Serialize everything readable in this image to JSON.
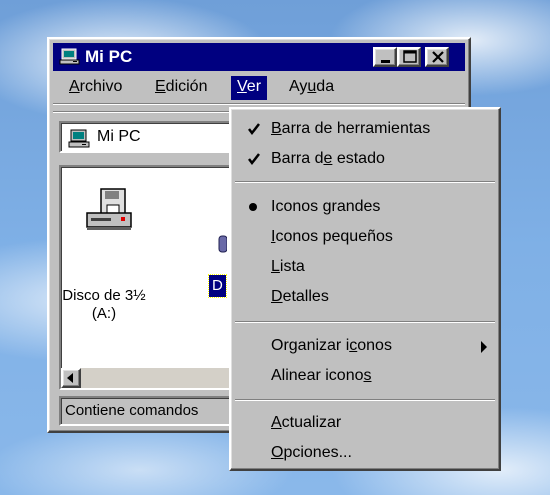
{
  "window": {
    "title": "Mi PC",
    "colors": {
      "titlebar": "#000080",
      "face": "#c0c0c0",
      "menu_highlight": "#000080"
    }
  },
  "menubar": {
    "items": [
      {
        "label": "Archivo",
        "underline": "A",
        "rest": "rchivo"
      },
      {
        "label": "Edición",
        "underline": "E",
        "rest": "dición"
      },
      {
        "label": "Ver",
        "underline": "V",
        "rest": "er"
      },
      {
        "label": "Ayuda",
        "pre": "Ay",
        "underline": "u",
        "rest": "da"
      }
    ]
  },
  "address": {
    "label": "Mi PC",
    "icon": "computer-icon"
  },
  "content": {
    "items": [
      {
        "label_line1": "Disco de 3½",
        "label_line2": "(A:)",
        "icon": "floppy-drive-icon"
      },
      {
        "label_partial": "D",
        "icon": "disk-icon",
        "selected": true
      }
    ]
  },
  "status": {
    "text": "Contiene comandos"
  },
  "ver_menu": {
    "items": [
      {
        "pre": "",
        "u": "B",
        "post": "arra de herramientas",
        "mark": "check"
      },
      {
        "pre": "Barra d",
        "u": "e",
        "post": " estado",
        "mark": "check"
      },
      {
        "pre": "Iconos ",
        "u": "g",
        "post": "randes",
        "mark": "bullet"
      },
      {
        "pre": "",
        "u": "I",
        "post": "conos pequeños",
        "mark": "none"
      },
      {
        "pre": "",
        "u": "L",
        "post": "ista",
        "mark": "none"
      },
      {
        "pre": "",
        "u": "D",
        "post": "etalles",
        "mark": "none"
      },
      {
        "pre": "Organizar i",
        "u": "c",
        "post": "onos",
        "mark": "none",
        "submenu": true
      },
      {
        "pre": "Alinear icono",
        "u": "s",
        "post": "",
        "mark": "none"
      },
      {
        "pre": "",
        "u": "A",
        "post": "ctualizar",
        "mark": "none"
      },
      {
        "pre": "",
        "u": "O",
        "post": "pciones...",
        "mark": "none"
      }
    ]
  }
}
